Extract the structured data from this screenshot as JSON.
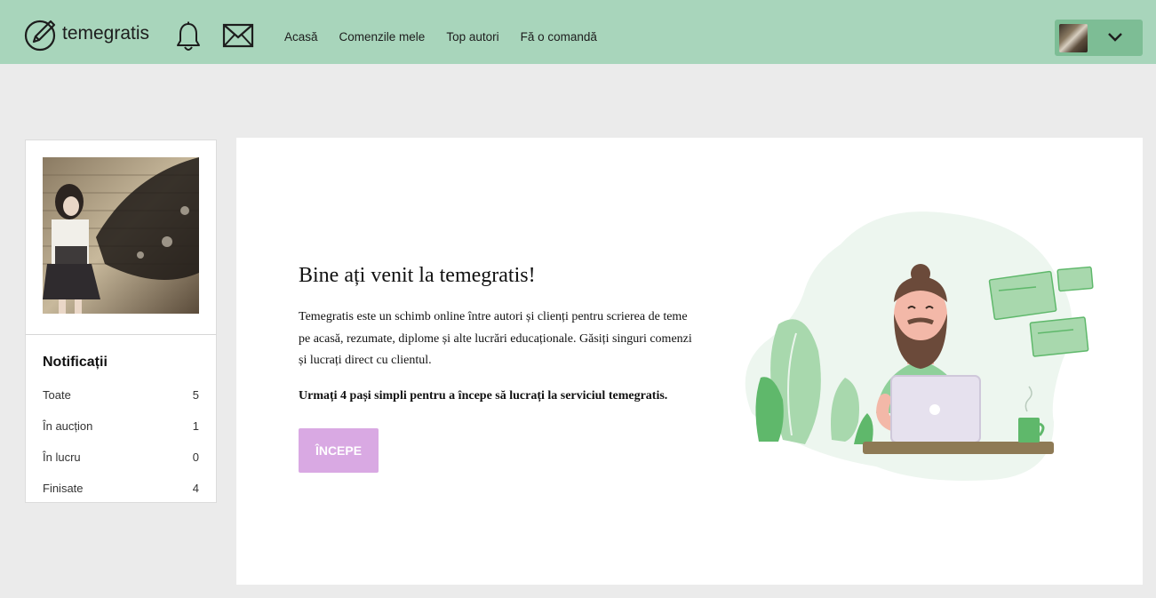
{
  "header": {
    "logo_text": "temegratis",
    "logo_icon": "pen-circle-icon",
    "nav": [
      {
        "label": "Acasă"
      },
      {
        "label": "Comenzile mele"
      },
      {
        "label": "Top autori"
      },
      {
        "label": "Fă o comandă"
      }
    ],
    "colors": {
      "bar": "#a8d5bb",
      "user_menu": "#7dbd95"
    }
  },
  "sidebar": {
    "notifications_title": "Notificații",
    "rows": [
      {
        "label": "Toate",
        "count": "5"
      },
      {
        "label": "În aucțion",
        "count": "1"
      },
      {
        "label": "În lucru",
        "count": "0"
      },
      {
        "label": "Finisate",
        "count": "4"
      }
    ]
  },
  "main": {
    "title": "Bine ați venit la temegratis!",
    "description": "Temegratis este un schimb online între autori și clienți pentru scrierea de teme pe acasă, rezumate, diplome și alte lucrări educaționale. Găsiți singuri comenzi și lucrați direct cu clientul.",
    "steps": "Urmați 4 pași simpli pentru a începe să lucrați la serviciul temegratis.",
    "start_button": "ÎNCEPE",
    "colors": {
      "button": "#d9a9e3"
    }
  }
}
